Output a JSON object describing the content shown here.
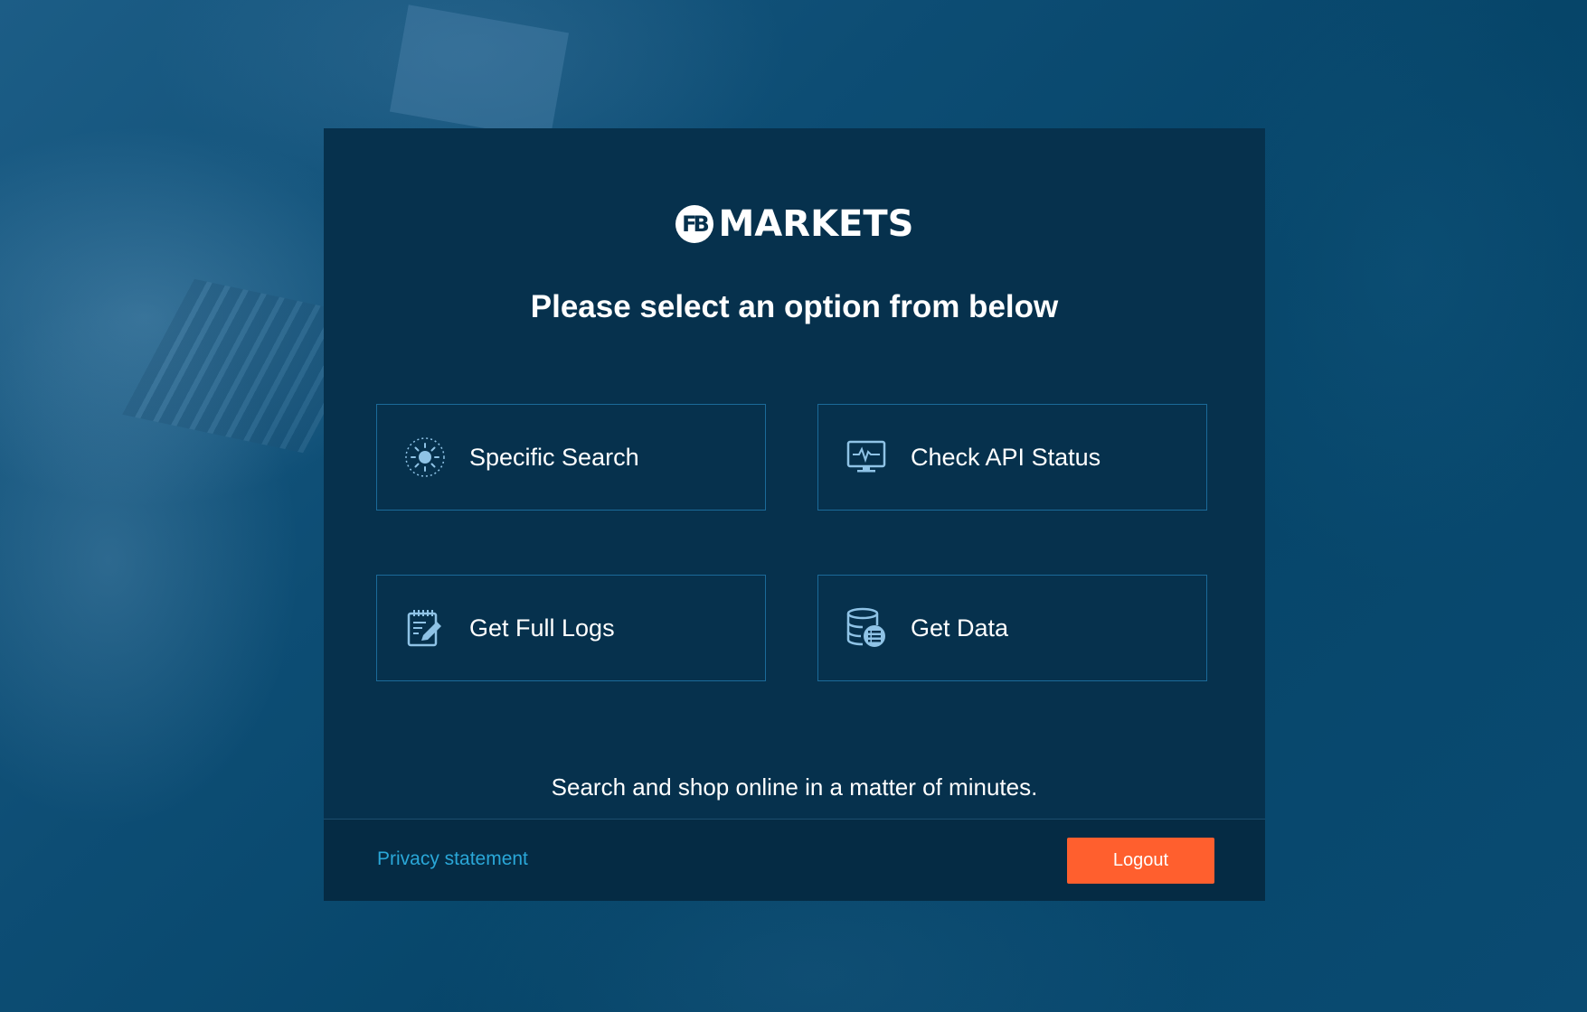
{
  "brand": {
    "logo_mark": "FB",
    "name": "MARKETS"
  },
  "heading": "Please select an option from below",
  "options": [
    {
      "label": "Specific Search",
      "icon": "sun-search-icon"
    },
    {
      "label": "Check API Status",
      "icon": "monitor-pulse-icon"
    },
    {
      "label": "Get Full Logs",
      "icon": "notepad-edit-icon"
    },
    {
      "label": "Get Data",
      "icon": "database-list-icon"
    }
  ],
  "tagline": "Search and shop online in a matter of minutes.",
  "footer": {
    "privacy_label": "Privacy statement",
    "logout_label": "Logout"
  },
  "colors": {
    "card_bg": "#06314d",
    "option_border": "#1b6a99",
    "accent_orange": "#ff5f2e",
    "link_blue": "#2aa7d8",
    "icon_blue": "#8fc3e6"
  }
}
